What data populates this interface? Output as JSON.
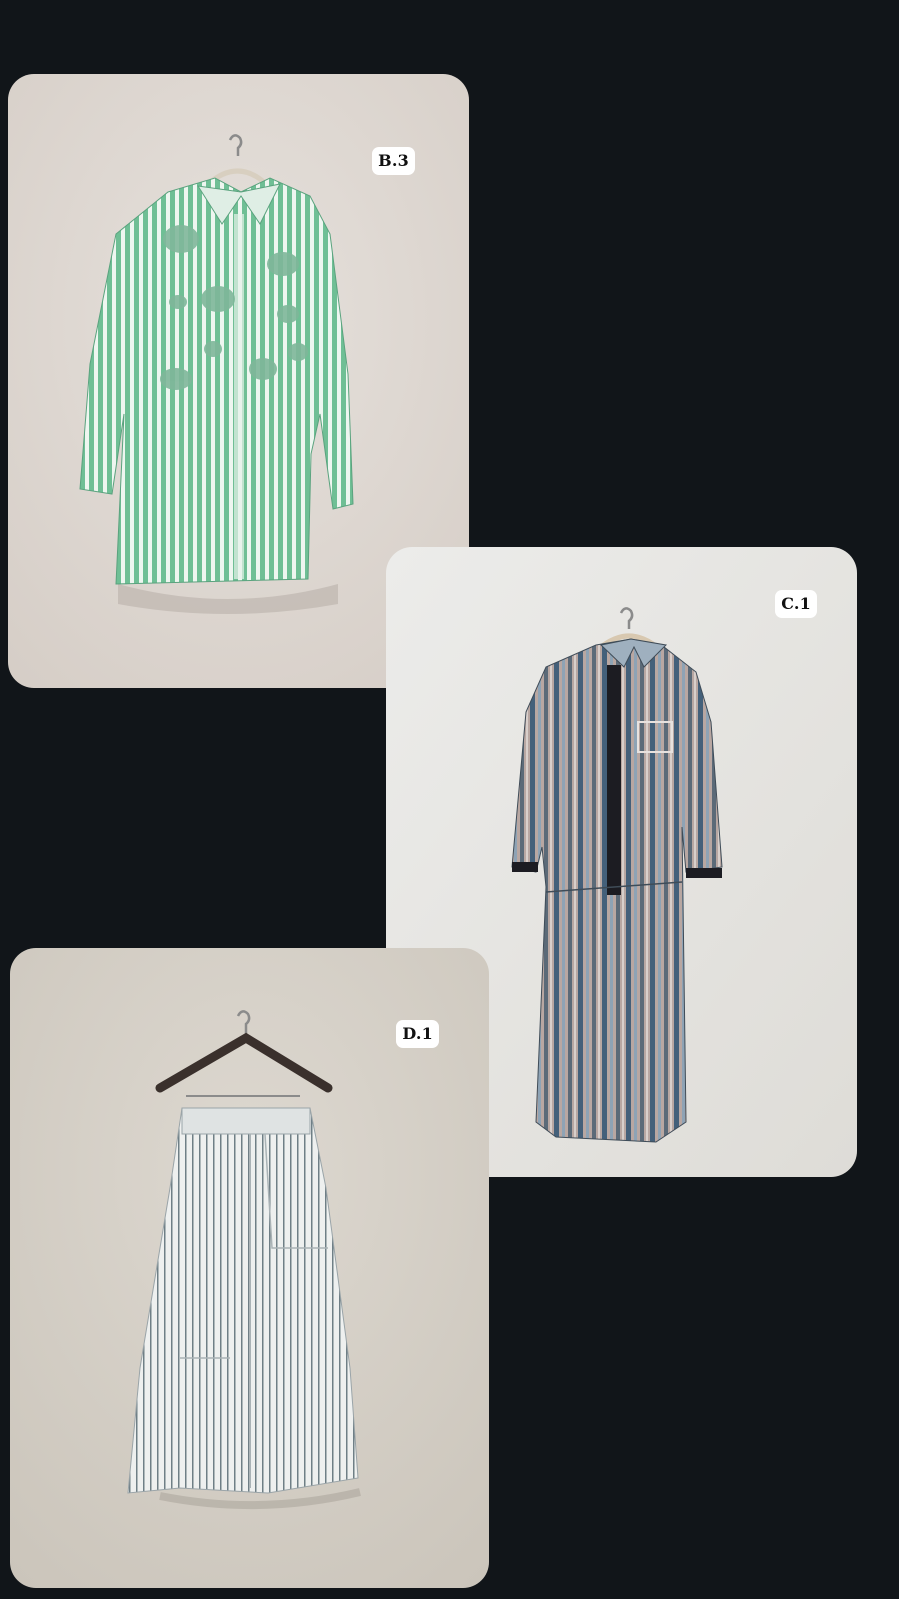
{
  "page": {
    "background": "#111519"
  },
  "cards": [
    {
      "tag": "B.3",
      "garment": "green-striped-embroidered-shirt",
      "wall_color": "#e3ddd8",
      "fabric_color": "#6fbf95"
    },
    {
      "tag": "C.1",
      "garment": "blue-grey-striped-shirt-dress",
      "wall_color": "#e9e8e4",
      "fabric_color": "#7d8ea0"
    },
    {
      "tag": "D.1",
      "garment": "white-striped-maxi-skirt",
      "wall_color": "#d9d4cc",
      "fabric_color": "#e6e8e7"
    }
  ]
}
